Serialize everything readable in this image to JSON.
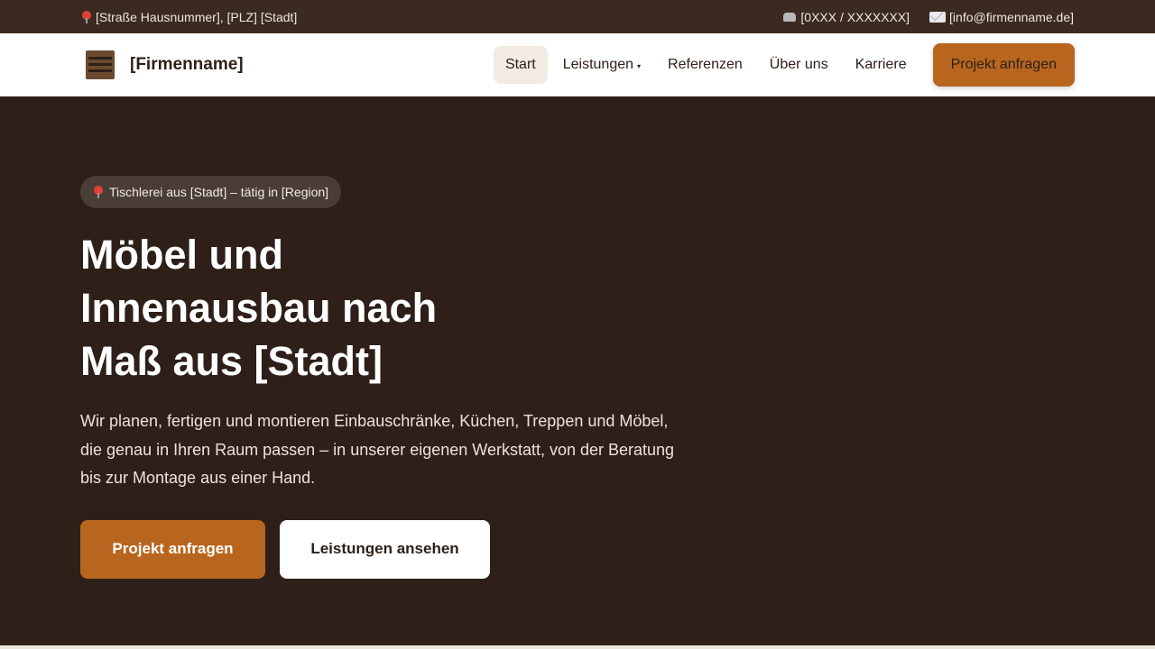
{
  "topbar": {
    "address": "[Straße Hausnummer], [PLZ] [Stadt]",
    "phone": "[0XXX / XXXXXXX]",
    "email": "[info@firmenname.de]",
    "icons": [
      "pin-icon",
      "phone-icon",
      "mail-icon"
    ]
  },
  "header": {
    "brand": "[Firmenname]",
    "nav": [
      {
        "label": "Start",
        "active": true
      },
      {
        "label": "Leistungen",
        "has_dropdown": true
      },
      {
        "label": "Referenzen"
      },
      {
        "label": "Über uns"
      },
      {
        "label": "Karriere"
      }
    ],
    "caret": "▾",
    "cta": "Projekt anfragen"
  },
  "hero": {
    "badge": "Tischlerei aus [Stadt] – tätig in [Region]",
    "headline": "Möbel und Innenausbau nach Maß aus [Stadt]",
    "lead": "Wir planen, fertigen und montieren Einbauschränke, Küchen, Treppen und Möbel, die genau in Ihren Raum passen – in unserer eigenen Werkstatt, von der Beratung bis zur Montage aus einer Hand.",
    "primary_button": "Projekt anfragen",
    "secondary_button": "Leistungen ansehen"
  },
  "colors": {
    "topbar_bg": "#3b2a1f",
    "hero_bg": "#2e2018",
    "accent": "#b8661f",
    "active_nav_bg": "#f2ebe3"
  }
}
